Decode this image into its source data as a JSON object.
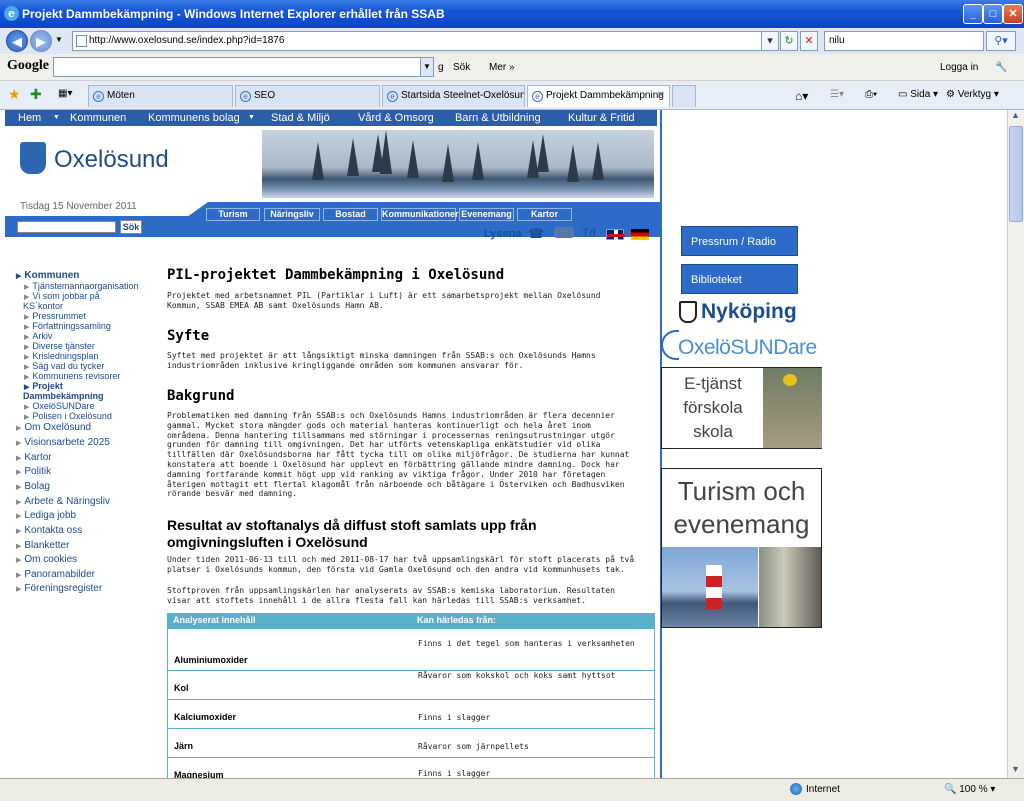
{
  "window": {
    "title": "Projekt Dammbekämpning - Windows Internet Explorer erhållet från SSAB",
    "controls": {
      "min": "_",
      "max": "□",
      "close": "✕"
    }
  },
  "addressbar": {
    "url": "http://www.oxelosund.se/index.php?id=1876",
    "search_value": "nilu"
  },
  "google_toolbar": {
    "logo": "Google",
    "search_label": "Sök",
    "more_label": "Mer »",
    "login_label": "Logga in"
  },
  "tabs": [
    {
      "label": "Möten"
    },
    {
      "label": "SEO"
    },
    {
      "label": "Startsida Steelnet-Oxelösund"
    },
    {
      "label": "Projekt Dammbekämpning"
    }
  ],
  "command_bar": {
    "page": "Sida",
    "tools": "Verktyg"
  },
  "site": {
    "topnav": [
      "Hem",
      "Kommunen",
      "Kommunens bolag",
      "Stad & Miljö",
      "Vård & Omsorg",
      "Barn & Utbildning",
      "Kultur & Fritid"
    ],
    "logo_text": "Oxelösund",
    "date": "Tisdag 15 November 2011",
    "subnav": [
      "Turism",
      "Näringsliv",
      "Bostad",
      "Kommunikationer",
      "Evenemang",
      "Kartor"
    ],
    "search_button": "Sök",
    "lyssna": "Lyssna",
    "tt": "T/t"
  },
  "leftmenu": {
    "kommunen": "Kommunen",
    "sub": [
      "Tjänstemannaorganisation",
      "Vi som jobbar på",
      "KS`kontor",
      "Pressrummet",
      "Författningssamling",
      "Arkiv",
      "Diverse tjänster",
      "Krisledningsplan",
      "Säg vad du tycker",
      "Kommunens revisorer"
    ],
    "projekt1": "Projekt",
    "projekt2": "Dammbekämpning",
    "sub2": [
      "OxelöSUNDare",
      "Polisen i Oxelösund"
    ],
    "main": [
      "Om Oxelösund",
      "Visionsarbete 2025",
      "Kartor",
      "Politik",
      "Bolag",
      "Arbete & Näringsliv",
      "Lediga jobb",
      "Kontakta oss",
      "Blanketter",
      "Om cookies",
      "Panoramabilder",
      "Föreningsregister"
    ]
  },
  "content": {
    "h1": "PIL-projektet Dammbekämpning i Oxelösund",
    "intro": "Projektet med arbetsnamnet PIL (Partiklar i Luft) är ett samarbetsprojekt mellan Oxelösund Kommun, SSAB EMEA AB samt Oxelösunds Hamn AB.",
    "h_syfte": "Syfte",
    "syfte": "Syftet med projektet är att långsiktigt minska damningen från SSAB:s och Oxelösunds Hamns industriområden inklusive kringliggande områden som kommunen ansvarar för.",
    "h_bakgrund": "Bakgrund",
    "bakgrund": "Problematiken med damning från SSAB:s och Oxelösunds Hamns industriområden är flera decennier gammal. Mycket stora mängder gods och material hanteras kontinuerligt och hela året inom områdena. Denna hantering tillsammans med störningar i processernas reningsutrustningar utgör grunden för damning till omgivningen. Det har utförts vetenskapliga enkätstudier vid olika tillfällen där Oxelösundsborna har fått tycka till om olika miljöfrågor. De studierna har kunnat konstatera att boende i Oxelösund har upplevt en förbättring gällande mindre damning. Dock har damning fortfarande kommit högt upp vid ranking av viktiga frågor. Under 2010 har företagen återigen mottagit ett flertal klagomål från närboende och båtägare i Österviken och Badhusviken rörande besvär med damning.",
    "h_resultat": "Resultat av stoftanalys då diffust stoft samlats upp från omgivningsluften i Oxelösund",
    "resultat1": "Under tiden 2011-06-13 till och med 2011-08-17 har två uppsamlingskärl för stoft placerats på två platser i Oxelösunds kommun, den första vid Gamla Oxelösund och den andra vid kommunhusets tak.",
    "resultat2": "Stoftproven från uppsamlingskärlen har analyserats av SSAB:s kemiska laboratorium. Resultaten visar att stoftets innehåll i de allra flesta fall kan härledas till SSAB:s verksamhet.",
    "table": {
      "headers": [
        "Analyserat innehåll",
        "Kan härledas från:"
      ],
      "rows": [
        [
          "Aluminiumoxider",
          "Finns i det tegel som hanteras i verksamheten"
        ],
        [
          "Kol",
          "Råvaror som kokskol och koks samt hyttsot"
        ],
        [
          "Kalciumoxider",
          "Finns i slagger"
        ],
        [
          "Järn",
          "Råvaror som järnpellets"
        ],
        [
          "Magnesium",
          "Finns i slagger"
        ]
      ]
    }
  },
  "rightcol": {
    "pressrum": "Pressrum / Radio",
    "bibliotek": "Biblioteket",
    "nykoping": "Nyköping",
    "oxelosundare": "OxelöSUNDare",
    "etjanst": [
      "E-tjänst",
      "förskola",
      "skola"
    ],
    "turism": [
      "Turism och",
      "evenemang"
    ]
  },
  "statusbar": {
    "zone": "Internet",
    "zoom": "100 %"
  }
}
